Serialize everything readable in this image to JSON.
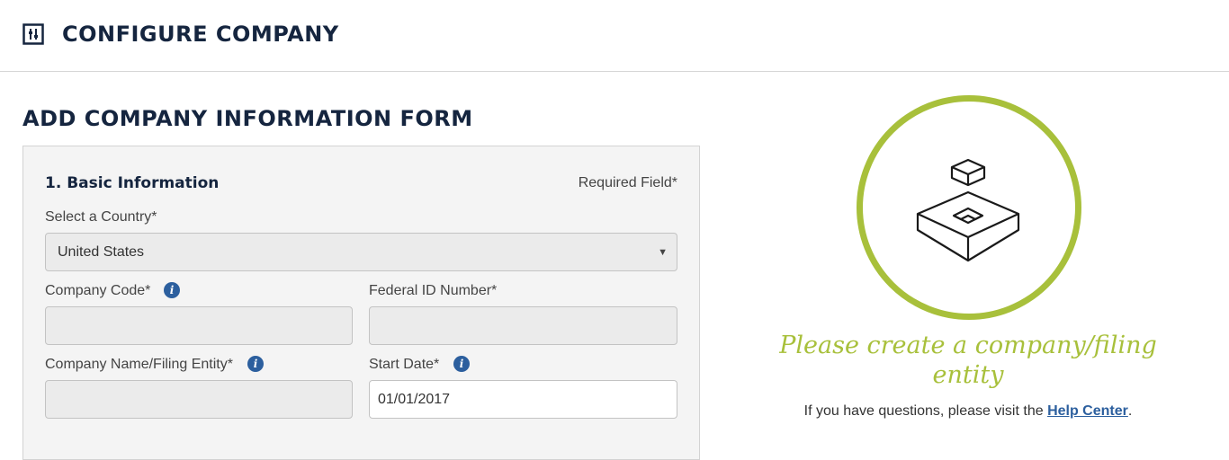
{
  "header": {
    "title": "CONFIGURE COMPANY",
    "icon": "settings-sliders-icon"
  },
  "form": {
    "title": "ADD COMPANY INFORMATION FORM",
    "section_title": "1. Basic Information",
    "required_note": "Required Field*",
    "country": {
      "label": "Select a Country*",
      "value": "United States"
    },
    "company_code": {
      "label": "Company Code*",
      "value": ""
    },
    "federal_id": {
      "label": "Federal ID Number*",
      "value": ""
    },
    "company_name": {
      "label": "Company Name/Filing Entity*",
      "value": ""
    },
    "start_date": {
      "label": "Start Date*",
      "value": "01/01/2017"
    },
    "info_icon": "info-icon"
  },
  "empty_state": {
    "title": "Please create a company/filing entity",
    "help_prefix": "If you have questions, please visit the ",
    "help_link": "Help Center",
    "help_suffix": ".",
    "illustration": "box-placement-icon",
    "accent_color": "#a8c03b"
  },
  "colors": {
    "heading": "#15253f",
    "link": "#2c5f9e",
    "accent": "#a8c03b"
  }
}
